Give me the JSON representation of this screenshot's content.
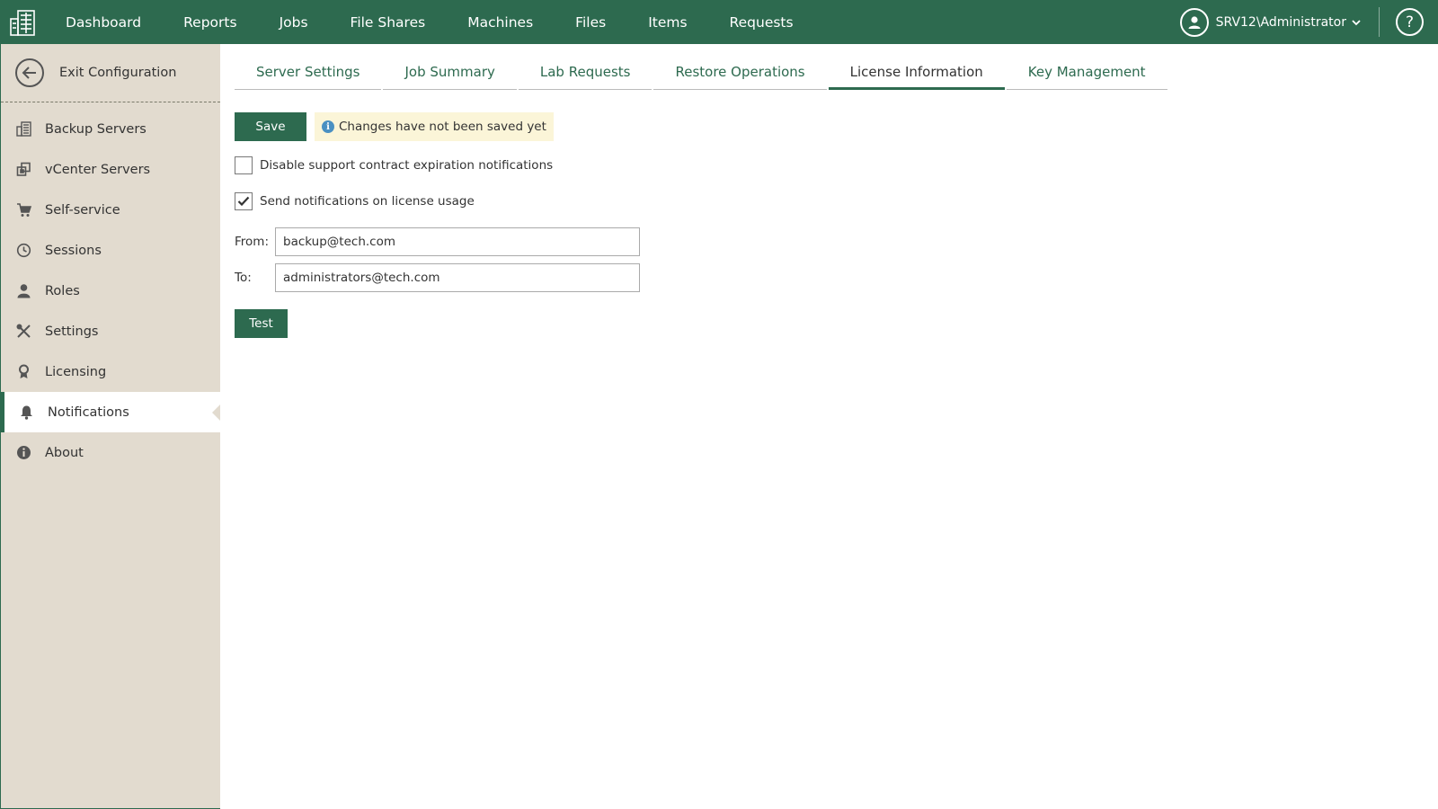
{
  "topbar": {
    "logo_icon": "building-grid-icon",
    "nav": [
      {
        "label": "Dashboard"
      },
      {
        "label": "Reports"
      },
      {
        "label": "Jobs"
      },
      {
        "label": "File Shares"
      },
      {
        "label": "Machines"
      },
      {
        "label": "Files"
      },
      {
        "label": "Items"
      },
      {
        "label": "Requests"
      }
    ],
    "user": "SRV12\\Administrator",
    "help_label": "?"
  },
  "sidebar": {
    "exit_label": "Exit Configuration",
    "items": [
      {
        "label": "Backup Servers",
        "icon": "backup-servers-icon"
      },
      {
        "label": "vCenter Servers",
        "icon": "vcenter-icon"
      },
      {
        "label": "Self-service",
        "icon": "cart-icon"
      },
      {
        "label": "Sessions",
        "icon": "clock-icon"
      },
      {
        "label": "Roles",
        "icon": "user-icon"
      },
      {
        "label": "Settings",
        "icon": "tools-icon"
      },
      {
        "label": "Licensing",
        "icon": "license-icon"
      },
      {
        "label": "Notifications",
        "icon": "bell-icon",
        "active": true
      },
      {
        "label": "About",
        "icon": "info-icon"
      }
    ]
  },
  "tabs": [
    {
      "label": "Server Settings"
    },
    {
      "label": "Job Summary"
    },
    {
      "label": "Lab Requests"
    },
    {
      "label": "Restore Operations"
    },
    {
      "label": "License Information",
      "active": true
    },
    {
      "label": "Key Management"
    }
  ],
  "form": {
    "save_label": "Save",
    "notice_text": "Changes have not been saved yet",
    "disable_support_label": "Disable support contract expiration notifications",
    "disable_support_checked": false,
    "send_usage_label": "Send notifications on license usage",
    "send_usage_checked": true,
    "from_label": "From:",
    "from_value": "backup@tech.com",
    "to_label": "To:",
    "to_value": "administrators@tech.com",
    "test_label": "Test"
  },
  "colors": {
    "accent": "#2d6a4f",
    "sidebar_bg": "#e2dbcf",
    "notice_bg": "#fbf5d8",
    "info": "#4a90c2"
  }
}
